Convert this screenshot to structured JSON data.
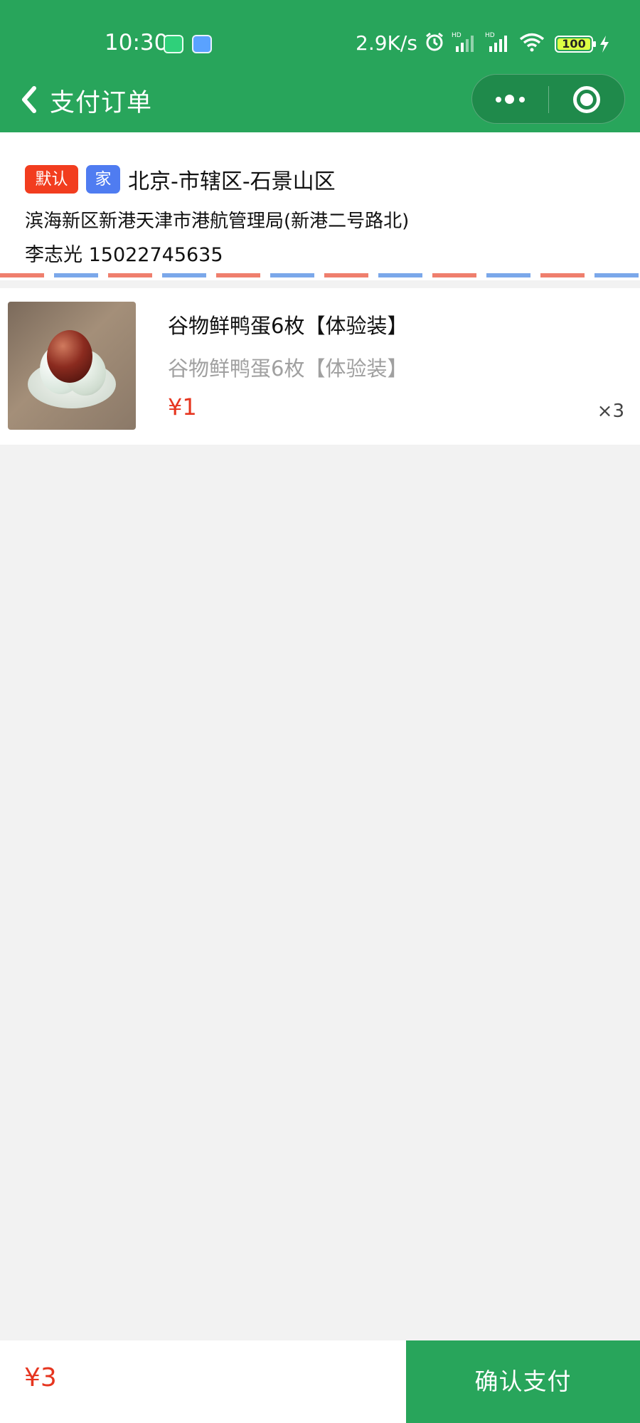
{
  "status_bar": {
    "time": "10:30",
    "network_speed": "2.9K/s",
    "battery": "100",
    "icons": [
      "shield-app-icon",
      "cloud-app-icon",
      "alarm-icon",
      "hd-signal-icon",
      "hd-signal-icon",
      "wifi-icon",
      "battery-icon",
      "charging-icon"
    ]
  },
  "nav": {
    "title": "支付订单",
    "back_icon": "chevron-left-icon",
    "more_icon": "more-dots-icon",
    "close_icon": "target-icon"
  },
  "address": {
    "tag_default": "默认",
    "tag_home": "家",
    "region": "北京-市辖区-石景山区",
    "street": "滨海新区新港天津市港航管理局(新港二号路北)",
    "contact": "李志光 15022745635"
  },
  "product": {
    "name": "谷物鲜鸭蛋6枚【体验装】",
    "spec": "谷物鲜鸭蛋6枚【体验装】",
    "price": "¥1",
    "quantity": "×3"
  },
  "footer": {
    "total": "¥3",
    "confirm_label": "确认支付"
  },
  "colors": {
    "brand_green": "#28a55b",
    "price_red": "#e6351f",
    "tag_default": "#f23d1f",
    "tag_home": "#4f7cf1"
  }
}
